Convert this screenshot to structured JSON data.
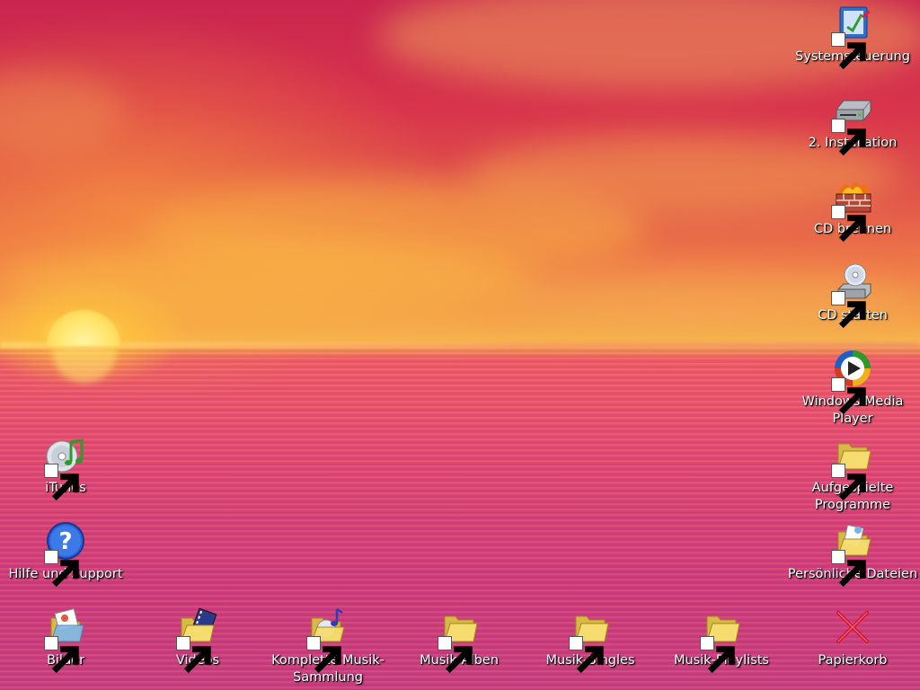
{
  "desktop": {
    "icons_right": [
      {
        "label": "Systemsteuerung",
        "icon": "control-panel-icon"
      },
      {
        "label": "2. Installation",
        "icon": "drive-icon"
      },
      {
        "label": "CD brennen",
        "icon": "cd-burn-icon"
      },
      {
        "label": "CD starten",
        "icon": "cd-drive-icon"
      },
      {
        "label": "Windows Media Player",
        "icon": "media-player-icon"
      },
      {
        "label": "Aufgespielte Programme",
        "icon": "folder-icon"
      },
      {
        "label": "Persönliche Dateien",
        "icon": "personal-folder-icon"
      }
    ],
    "icons_left": [
      {
        "label": "iTunes",
        "icon": "itunes-icon"
      },
      {
        "label": "Hilfe und Support",
        "icon": "help-icon"
      }
    ],
    "icons_bottom": [
      {
        "label": "Bilder",
        "icon": "pictures-folder-icon"
      },
      {
        "label": "Videos",
        "icon": "video-folder-icon"
      },
      {
        "label": "Komplette Musik-Sammlung",
        "icon": "music-folder-icon"
      },
      {
        "label": "Musik-Alben",
        "icon": "folder-icon"
      },
      {
        "label": "Musik-Singles",
        "icon": "folder-icon"
      },
      {
        "label": "Musik-Playlists",
        "icon": "folder-icon"
      },
      {
        "label": "Papierkorb",
        "icon": "recycle-bin-icon"
      }
    ]
  },
  "colors": {
    "sky": "#c9254f",
    "sun": "#ffe46a",
    "folder": "#f6dc6e",
    "label_text": "#ffffff"
  }
}
